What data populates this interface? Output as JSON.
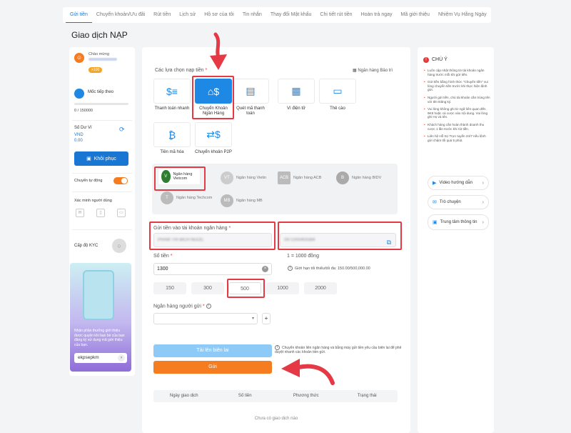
{
  "topnav": {
    "tabs": [
      "Gửi tiền",
      "Chuyển khoản/Ưu đãi",
      "Rút tiền",
      "Lịch sử",
      "Hồ sơ của tôi",
      "Tin nhắn",
      "Thay đổi Mật khẩu",
      "Chi tiết rút tiền",
      "Hoàn trả ngay",
      "Mã giới thiệu",
      "Nhiệm Vụ Hằng Ngày"
    ]
  },
  "page_title": "Giao dịch NẠP",
  "sidebar": {
    "greeting": "Chào mừng",
    "vip": ">100",
    "milestone_label": "Mốc tiếp theo",
    "milestone_value": "0 / 150000",
    "balance_title": "Số Dư Ví",
    "balance_currency": "VND",
    "balance_value": "0.00",
    "restore_label": "Khôi phục",
    "auto_transfer_label": "Chuyển tự động",
    "verify_title": "Xác minh người dùng",
    "kyc_label": "Cấp độ KYC",
    "promo_text": "Nhận phần thưởng giới thiệu được quyền khi bạn bè của bạn đăng ký sử dụng mã giới thiệu của bạn.",
    "promo_code": "ekpsepkm"
  },
  "main": {
    "method_section_label": "Các lựa chọn nạp tiền",
    "maintenance_label": "Ngân hàng Bảo trì",
    "methods": [
      {
        "label": "Thanh toán nhanh",
        "icon": "fast-pay"
      },
      {
        "label": "Chuyển Khoản Ngân Hàng",
        "icon": "bank-transfer"
      },
      {
        "label": "Quét mã thanh toán",
        "icon": "scan-code"
      },
      {
        "label": "Ví điện tử",
        "icon": "e-wallet"
      },
      {
        "label": "Thẻ cào",
        "icon": "scratch-card"
      },
      {
        "label": "Tiền mã hóa",
        "icon": "crypto"
      },
      {
        "label": "Chuyển khoản P2P",
        "icon": "p2p"
      }
    ],
    "banks": [
      {
        "name": "Ngân hàng Vietcom",
        "logo": "V"
      },
      {
        "name": "Ngân hàng Vietin",
        "logo": "VT"
      },
      {
        "name": "Ngân hàng ACB",
        "logo": "ACB"
      },
      {
        "name": "Ngân hàng BIDV",
        "logo": "B"
      },
      {
        "name": "Ngân hàng Techcom",
        "logo": "T"
      },
      {
        "name": "Ngân hàng MB",
        "logo": "MB"
      }
    ],
    "account_label": "Gửi tiền vào tài khoản ngân hàng",
    "account_name": "PHAM THI BICH NGOC",
    "account_number": "0971000403384",
    "amount_label": "Số tiền",
    "rate": "1 = 1000 đồng",
    "amount_value": "1300",
    "limit_text": "Giới hạn tối thiểu/tối đa: 150.00/500,000.00",
    "quick_amounts": [
      "150",
      "300",
      "500",
      "1000",
      "2000"
    ],
    "sender_bank_label": "Ngân hàng người gửi",
    "upload_label": "Tải lên biên lai",
    "upload_note": "Chuyển khoản liên ngân hàng và bằng máy gửi tiền yêu cầu biên lai để phê duyệt nhanh các khoản tiền gửi.",
    "send_label": "Gửi",
    "history_headers": [
      "Ngày giao dịch",
      "Số tiền",
      "Phương thức",
      "Trạng thái"
    ],
    "history_empty": "Chưa có giao dịch nào"
  },
  "right": {
    "title": "CHÚ Ý",
    "notes": [
      "Luôn cập nhật thông tin tài khoản ngân hàng trước mỗi khi gửi tiền.",
      "Gửi tiền bằng hình thức \"Chuyển tiền\" vui lòng chuyển tiền trước khi thực hiện lệnh gửi.",
      "Người gửi tiền, chủ tài khoản cần trùng tên với tên Đăng ký.",
      "Vui lòng không ghi từ ngữ liên quan đến 9K8 hoặc cá cược vào nội dung. Vui lòng ghi Họ và tên.",
      "Khách hàng cần hoàn thành doanh thu cược 1 lần trước khi rút tiền.",
      "Liên hệ Hỗ trợ Trực tuyến 24/7 nếu lệnh gửi chậm tối quá 5 phút."
    ],
    "links": [
      "Video hướng dẫn",
      "Trò chuyện",
      "Trung tâm thông tin"
    ]
  }
}
